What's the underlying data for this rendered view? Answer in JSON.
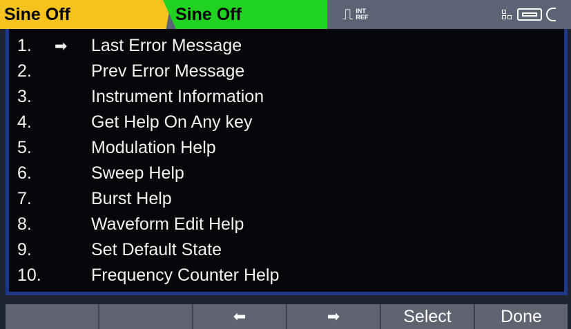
{
  "status_bar": {
    "ch1_label": "Sine Off",
    "ch2_label": "Sine Off",
    "ref_top": "INT",
    "ref_bottom": "REF"
  },
  "help_menu": {
    "selected_index": 0,
    "items": [
      {
        "num": "1.",
        "label": "Last Error Message"
      },
      {
        "num": "2.",
        "label": "Prev Error Message"
      },
      {
        "num": "3.",
        "label": "Instrument Information"
      },
      {
        "num": "4.",
        "label": "Get Help On Any key"
      },
      {
        "num": "5.",
        "label": "Modulation Help"
      },
      {
        "num": "6.",
        "label": "Sweep Help"
      },
      {
        "num": "7.",
        "label": "Burst Help"
      },
      {
        "num": "8.",
        "label": "Waveform Edit Help"
      },
      {
        "num": "9.",
        "label": "Set Default State"
      },
      {
        "num": "10.",
        "label": "Frequency Counter Help"
      }
    ]
  },
  "softkeys": {
    "key1": "",
    "key2": "",
    "key3": "⬅",
    "key4": "➡",
    "key5": "Select",
    "key6": "Done"
  },
  "icons": {
    "selection_arrow": "➡",
    "ref_glyph": "⎍"
  },
  "colors": {
    "ch1_tab": "#f6c21e",
    "ch2_tab": "#21d321",
    "frame": "#20388a",
    "softkey": "#5f6470"
  }
}
